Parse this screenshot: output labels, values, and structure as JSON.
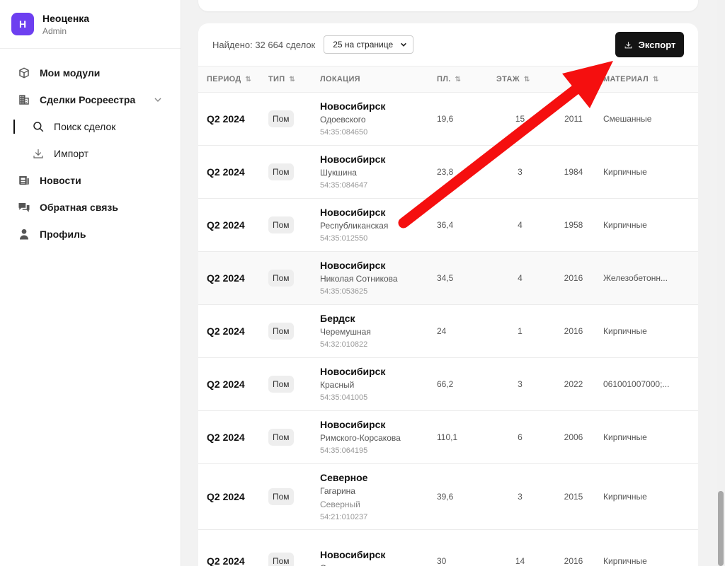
{
  "brand": {
    "logo_letter": "Н",
    "name": "Неоценка",
    "role": "Admin",
    "accent": "#6d3ff0"
  },
  "nav": {
    "modules": "Мои модули",
    "deals": "Сделки Росреестра",
    "search": "Поиск сделок",
    "import": "Импорт",
    "news": "Новости",
    "feedback": "Обратная связь",
    "profile": "Профиль"
  },
  "toolbar": {
    "found": "Найдено: 32 664 сделок",
    "per_page": "25 на странице",
    "export": "Экспорт"
  },
  "table": {
    "columns": [
      "ПЕРИОД",
      "ТИП",
      "ЛОКАЦИЯ",
      "ПЛ.",
      "ЭТАЖ",
      "",
      "МАТЕРИАЛ"
    ],
    "rows": [
      {
        "period": "Q2 2024",
        "type": "Пом",
        "city": "Новосибирск",
        "street": "Одоевского",
        "code": "54:35:084650",
        "area": "19,6",
        "floor": "15",
        "year": "2011",
        "material": "Смешанные"
      },
      {
        "period": "Q2 2024",
        "type": "Пом",
        "city": "Новосибирск",
        "street": "Шукшина",
        "code": "54:35:084647",
        "area": "23,8",
        "floor": "3",
        "year": "1984",
        "material": "Кирпичные"
      },
      {
        "period": "Q2 2024",
        "type": "Пом",
        "city": "Новосибирск",
        "street": "Республиканская",
        "code": "54:35:012550",
        "area": "36,4",
        "floor": "4",
        "year": "1958",
        "material": "Кирпичные"
      },
      {
        "period": "Q2 2024",
        "type": "Пом",
        "city": "Новосибирск",
        "street": "Николая Сотникова",
        "code": "54:35:053625",
        "area": "34,5",
        "floor": "4",
        "year": "2016",
        "material": "Железобетонн..."
      },
      {
        "period": "Q2 2024",
        "type": "Пом",
        "city": "Бердск",
        "street": "Черемушная",
        "code": "54:32:010822",
        "area": "24",
        "floor": "1",
        "year": "2016",
        "material": "Кирпичные"
      },
      {
        "period": "Q2 2024",
        "type": "Пом",
        "city": "Новосибирск",
        "street": "Красный",
        "code": "54:35:041005",
        "area": "66,2",
        "floor": "3",
        "year": "2022",
        "material": "061001007000;..."
      },
      {
        "period": "Q2 2024",
        "type": "Пом",
        "city": "Новосибирск",
        "street": "Римского-Корсакова",
        "code": "54:35:064195",
        "area": "110,1",
        "floor": "6",
        "year": "2006",
        "material": "Кирпичные"
      },
      {
        "period": "Q2 2024",
        "type": "Пом",
        "city": "Северное",
        "street": "Гагарина",
        "street2": "Северный",
        "code": "54:21:010237",
        "area": "39,6",
        "floor": "3",
        "year": "2015",
        "material": "Кирпичные"
      },
      {
        "period": "Q2 2024",
        "type": "Пом",
        "city": "Новосибирск",
        "street": "Оловозаводская",
        "code": "",
        "area": "30",
        "floor": "14",
        "year": "2016",
        "material": "Кирпичные"
      }
    ]
  },
  "annotation": {
    "type": "red-arrow",
    "color": "#f50f0f",
    "points_to": "export-button"
  }
}
